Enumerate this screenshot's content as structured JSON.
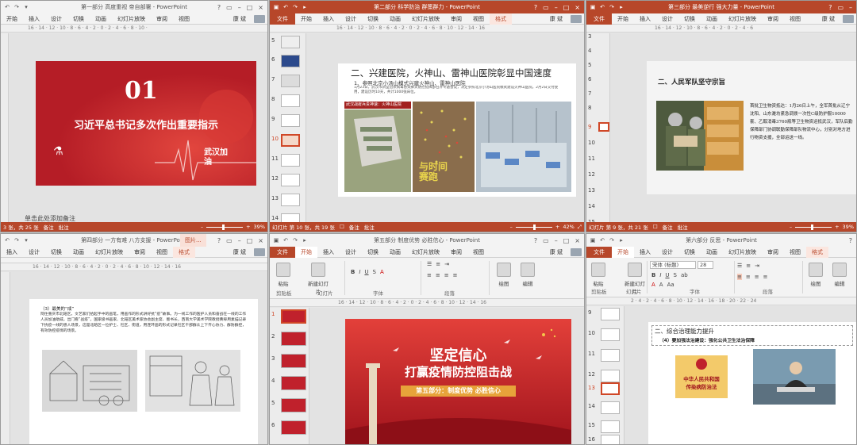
{
  "w1": {
    "title": "第一部分 高度重视 帝自部署 - PowerPoint",
    "tabs": [
      "开始",
      "插入",
      "设计",
      "切换",
      "动画",
      "幻灯片放映",
      "审阅",
      "视图"
    ],
    "user": "康 斌",
    "ruler": "16 · 14 · 12 · 10 · 8 · 6 · 4 · 2 · 0 · 2 · 4 · 6 · 8 · 10 ·",
    "slide": {
      "number": "01",
      "heading": "习近平总书记多次作出重要指示",
      "tag": "武汉加油"
    },
    "notes": "单击此处添加备注",
    "status": {
      "slide_info": "3 张，共 25 张",
      "notes_label": "备注",
      "comments_label": "批注",
      "zoom": "39%"
    }
  },
  "w2": {
    "title": "第二部分 科学防治 群策群力 - PowerPoint",
    "tabs": [
      "文件",
      "开始",
      "插入",
      "设计",
      "切换",
      "动画",
      "幻灯片放映",
      "审阅",
      "视图",
      "格式"
    ],
    "user": "康 斌",
    "ruler": "16 · 14 · 12 · 10 · 8 · 6 · 4 · 2 · 0 · 2 · 4 · 6 · 8 · 10 · 12 · 14 · 16",
    "thumbs": [
      "5",
      "6",
      "7",
      "8",
      "9",
      "10",
      "11",
      "12",
      "13",
      "14"
    ],
    "selected_thumb": "10",
    "slide": {
      "heading": "二、兴建医院，火神山、雷神山医院彰显中国速度",
      "sub": "1、参照北京小汤山模式兴建火神山、雷神山医院",
      "para": "1月23日，武汉市新型冠状病毒感染肺炎防控指挥部召开专题会议，决定参照北京小汤山医院模式建设火神山医院。2月2日交付使用，建设历时10天，共计1000张床位。",
      "banner": "武汉战疫兵贵神速：火神山医院",
      "poster": "与时间赛跑"
    },
    "status": {
      "slide_info": "幻灯片 第 10 张，共 19 张",
      "notes_label": "备注",
      "comments_label": "批注",
      "zoom": "42%"
    }
  },
  "w3": {
    "title": "第三部分 最美逆行 强大力量 - PowerPoint",
    "tabs": [
      "文件",
      "开始",
      "插入",
      "设计",
      "切换",
      "动画",
      "幻灯片放映",
      "审阅",
      "视图"
    ],
    "user": "康 斌",
    "ruler": "16 · 14 · 12 · 10 · 8 · 6 · 4 · 2 · 0 · 2 · 4 · 6",
    "thumbs": [
      "3",
      "4",
      "5",
      "6",
      "7",
      "8",
      "9",
      "10",
      "11",
      "12",
      "13",
      "14",
      "15"
    ],
    "selected_thumb": "9",
    "slide": {
      "heading": "二、人民军队坚守宗旨",
      "para": "首批卫生物资抵达：1月26日上午，全军首批从辽宁沈阳、山东潍坊紧急调拨一次性C级防护服10000套、乙醇消毒3760瓶等卫生物资运抵武汉，军队后勤保障部门协调联勤保障部队物流中心，分别对地方进行物资支援，全部运送一线。"
    },
    "status": {
      "slide_info": "幻灯片 第 9 张，共 21 张",
      "notes_label": "备注",
      "comments_label": "批注",
      "zoom": "39%"
    }
  },
  "w4": {
    "title": "第四部分 一方有难 八方支援 - PowerPoint",
    "ctx": "图片...",
    "tabs": [
      "插入",
      "设计",
      "切换",
      "动画",
      "幻灯片放映",
      "审阅",
      "视图",
      "格式"
    ],
    "user": "康 斌",
    "ruler": "16 · 14 · 12 · 10 · 8 · 6 · 4 · 2 · 0 · 2 · 4 · 6 · 8 · 10 · 12 · 14 · 16",
    "slide": {
      "bullet1": "（3）最美的“成”",
      "bullet2": "阿住重庆市北碚区，文艺家们拾起手中的画笔，用画作的形式讲好抗“疫”故事。为一线工作的医护人员和奋战在一线的工作人员加油助威，出门看“战疫”。国家级书画家、北碚区美术家协会副主席、版书长，西南大学美术学院教授黄稼用素描记录下抗疫一线的感人场景，这是北碚区一位护士、社区、街道，用连环画的形式记录社区干部群众上下齐心协力、群防群控，有效防控疫情的场景。"
    }
  },
  "w5": {
    "title": "第五部分 制度优势 必胜信心 - PowerPoint",
    "tabs": [
      "文件",
      "开始",
      "插入",
      "设计",
      "切换",
      "动画",
      "幻灯片放映",
      "审阅",
      "视图"
    ],
    "user": "康 斌",
    "ribbon": {
      "paste": "粘贴",
      "new_slide": "新建幻灯片",
      "clipboard": "剪贴板",
      "slides": "幻灯片",
      "font": "字体",
      "paragraph": "段落",
      "drawing": "绘图",
      "editing": "编辑"
    },
    "ruler": "16 · 14 · 12 · 10 · 8 · 6 · 4 · 2 · 0 · 2 · 4 · 6 · 8 · 10 · 12 · 14 · 16",
    "thumbs": [
      "1",
      "2",
      "3",
      "4",
      "5",
      "6"
    ],
    "selected_thumb": "1",
    "slide": {
      "title1": "坚定信心",
      "title2": "打赢疫情防控阻击战",
      "subtitle": "第五部分：制度优势 必胜信心"
    }
  },
  "w6": {
    "title": "第六部分 反思 - PowerPoint",
    "tabs": [
      "文件",
      "开始",
      "插入",
      "设计",
      "切换",
      "动画",
      "幻灯片放映",
      "审阅",
      "视图",
      "格式"
    ],
    "user": "康 斌",
    "ribbon": {
      "paste": "粘贴",
      "new_slide": "新建幻灯片",
      "clipboard": "剪贴板",
      "slides": "幻灯片",
      "font": "字体",
      "paragraph": "段落",
      "drawing": "绘图",
      "editing": "编辑",
      "font_name": "宋体 (标题)",
      "font_size": "28"
    },
    "ruler": "2 · 4 · 2 · 4 · 6 · 8 · 10 · 12 · 14 · 16 · 18 · 20 · 22 · 24",
    "thumbs": [
      "9",
      "10",
      "11",
      "12",
      "13",
      "14",
      "15",
      "16"
    ],
    "selected_thumb": "13",
    "slide": {
      "heading": "二、综合治理能力提升",
      "sub": "（4）要加强法治建设：强化公共卫生法治保障",
      "book_line1": "中华人民共和国",
      "book_line2": "传染病防治法"
    }
  }
}
